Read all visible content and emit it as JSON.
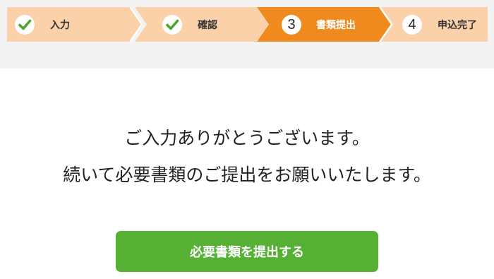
{
  "stepper": {
    "steps": [
      {
        "label": "入力",
        "marker": "check-icon",
        "state": "complete"
      },
      {
        "label": "確認",
        "marker": "check-icon",
        "state": "complete"
      },
      {
        "label": "書類提出",
        "number": "3",
        "state": "current"
      },
      {
        "label": "申込完了",
        "number": "4",
        "state": "upcoming"
      }
    ]
  },
  "message": {
    "line1": "ご入力ありがとうございます。",
    "line2": "続いて必要書類のご提出をお願いいたします。"
  },
  "actions": {
    "submit_label": "必要書類を提出する"
  },
  "colors": {
    "step_inactive": "#fad1a8",
    "step_active": "#f08a1f",
    "check": "#4ca431",
    "button": "#55b034",
    "band": "#f3f3f3"
  }
}
